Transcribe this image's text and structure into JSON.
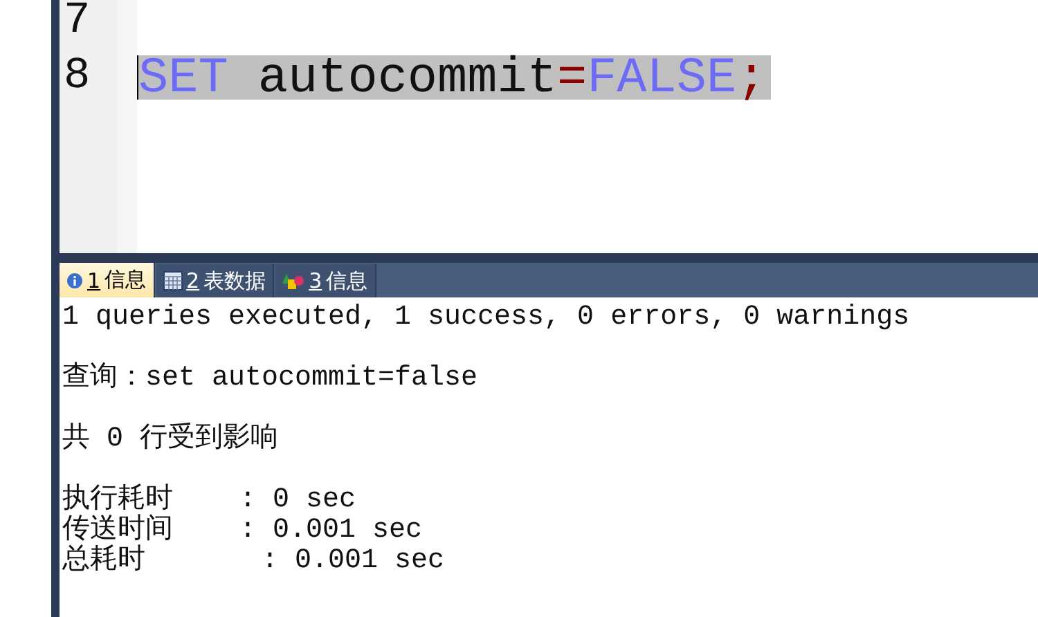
{
  "editor": {
    "lines": [
      {
        "number": "7"
      },
      {
        "number": "8",
        "selected": true,
        "caret": true,
        "tokens": [
          {
            "kind": "keyword",
            "text": "SET"
          },
          {
            "kind": "plain",
            "text": " autocommit"
          },
          {
            "kind": "operator",
            "text": "="
          },
          {
            "kind": "keyword",
            "text": "FALSE"
          },
          {
            "kind": "operator",
            "text": ";"
          }
        ]
      }
    ]
  },
  "tabs": [
    {
      "key": "1",
      "label": "信息",
      "kind": "info",
      "selected": true
    },
    {
      "key": "2",
      "label": "表数据",
      "kind": "grid",
      "selected": false
    },
    {
      "key": "3",
      "label": "信息",
      "kind": "shapes",
      "selected": false
    }
  ],
  "output": {
    "paragraphs": [
      [
        "1 queries executed, 1 success, 0 errors, 0 warnings"
      ],
      [
        "查询：set autocommit=false"
      ],
      [
        "共 0 行受到影响"
      ],
      [
        "执行耗时    : 0 sec",
        "传送时间    : 0.001 sec",
        "总耗时       : 0.001 sec"
      ]
    ]
  }
}
